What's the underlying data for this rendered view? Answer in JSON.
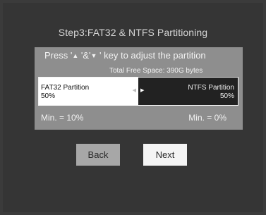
{
  "title": "Step3:FAT32 & NTFS Partitioning",
  "instruction": {
    "prefix": "Press '",
    "up_arrow": "▲",
    "middle": " '&'",
    "down_arrow": "▼",
    "suffix": " ' key to adjust the partition"
  },
  "free_space": "Total Free Space: 390G bytes",
  "partition": {
    "fat32_label": "FAT32 Partition",
    "fat32_percent": "50%",
    "fat32_fraction": 0.5,
    "ntfs_label": "NTFS Partition",
    "ntfs_percent": "50%",
    "left_arrow": "◀",
    "right_arrow": "▶"
  },
  "minimums": {
    "fat32": "Min. = 10%",
    "ntfs": "Min. = 0%"
  },
  "buttons": {
    "back": "Back",
    "next": "Next"
  },
  "colors": {
    "background": "#353535",
    "panel": "#8e8e8e",
    "fat32_segment": "#ffffff",
    "ntfs_segment": "#222222",
    "focused_button": "#f4f4f4",
    "unfocused_button": "#a7a7a7"
  }
}
